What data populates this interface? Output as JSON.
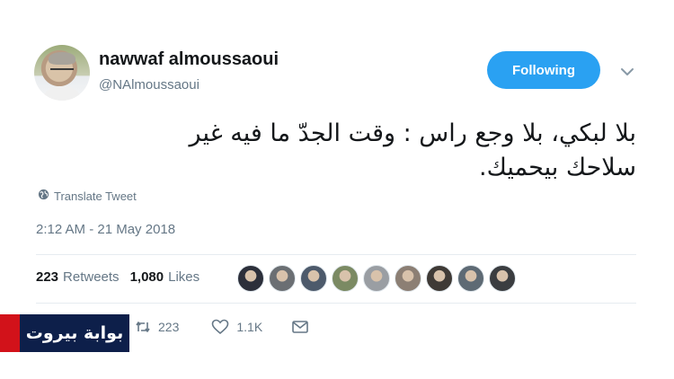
{
  "user": {
    "display_name": "nawwaf almoussaoui",
    "screen_name": "@NAlmoussaoui"
  },
  "follow_button": {
    "label": "Following",
    "color": "#2aa1f2"
  },
  "tweet": {
    "line1": "بلا لبكي، بلا وجع راس : وقت الجدّ ما فيه غير",
    "line2": "سلاحك بيحميك."
  },
  "translate": {
    "label": "Translate Tweet",
    "icon": "globe-icon"
  },
  "timestamp": "2:12 AM - 21 May 2018",
  "stats": {
    "retweets_count": "223",
    "retweets_label": "Retweets",
    "likes_count": "1,080",
    "likes_label": "Likes"
  },
  "liker_avatars": [
    {
      "color": "#2c2f3a"
    },
    {
      "color": "#6b6f73"
    },
    {
      "color": "#4d5a6b"
    },
    {
      "color": "#7b8a63"
    },
    {
      "color": "#9a9ea3"
    },
    {
      "color": "#8c7f74"
    },
    {
      "color": "#3f3a36"
    },
    {
      "color": "#5e6a74"
    },
    {
      "color": "#3b3d40"
    }
  ],
  "actions": {
    "retweet_count": "223",
    "like_count": "1.1K",
    "icons": [
      "reply-icon",
      "retweet-icon",
      "heart-icon",
      "message-icon"
    ]
  },
  "watermark": {
    "text": "بوابة بيروت",
    "colors": {
      "red": "#d2121a",
      "blue": "#0d1f4a"
    }
  }
}
